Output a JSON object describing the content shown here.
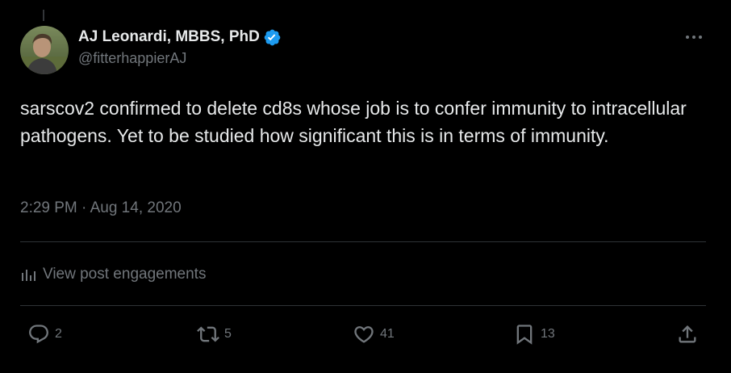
{
  "author": {
    "display_name": "AJ Leonardi, MBBS, PhD",
    "handle": "@fitterhappierAJ",
    "verified": true,
    "verified_color": "#1d9bf0"
  },
  "post": {
    "text": "sarscov2 confirmed to delete cd8s whose job is to confer immunity to intracellular pathogens. Yet to be studied how significant this is in terms of immunity.",
    "timestamp": "2:29 PM · Aug 14, 2020"
  },
  "engagements": {
    "label": "View post engagements",
    "icon": "bar-chart-icon"
  },
  "actions": {
    "reply": {
      "count": "2",
      "icon": "reply-icon"
    },
    "repost": {
      "count": "5",
      "icon": "repost-icon"
    },
    "like": {
      "count": "41",
      "icon": "heart-icon"
    },
    "bookmark": {
      "count": "13",
      "icon": "bookmark-icon"
    },
    "share": {
      "icon": "share-icon"
    }
  },
  "colors": {
    "background": "#000000",
    "text_primary": "#e7e9ea",
    "text_secondary": "#71767b",
    "divider": "#2f3336"
  }
}
